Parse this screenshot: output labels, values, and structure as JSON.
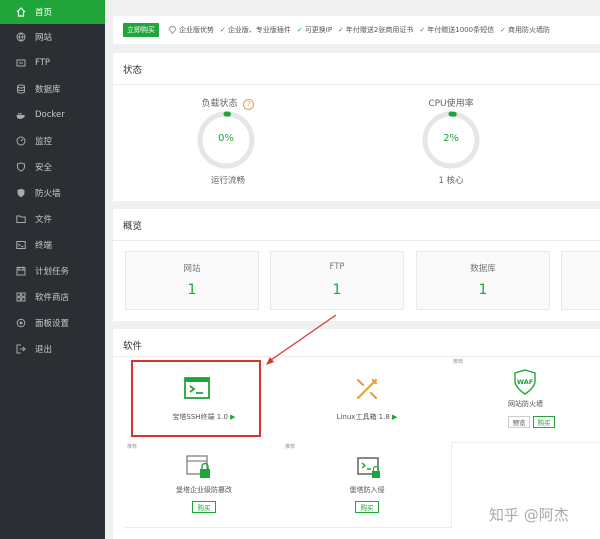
{
  "sidebar": {
    "items": [
      {
        "label": "首页",
        "icon": "home-icon",
        "active": true
      },
      {
        "label": "网站",
        "icon": "globe-icon"
      },
      {
        "label": "FTP",
        "icon": "ftp-icon"
      },
      {
        "label": "数据库",
        "icon": "database-icon"
      },
      {
        "label": "Docker",
        "icon": "docker-icon"
      },
      {
        "label": "监控",
        "icon": "monitor-icon"
      },
      {
        "label": "安全",
        "icon": "shield-icon"
      },
      {
        "label": "防火墙",
        "icon": "firewall-icon"
      },
      {
        "label": "文件",
        "icon": "folder-icon"
      },
      {
        "label": "终端",
        "icon": "terminal-icon"
      },
      {
        "label": "计划任务",
        "icon": "calendar-icon"
      },
      {
        "label": "软件商店",
        "icon": "grid-icon"
      },
      {
        "label": "面板设置",
        "icon": "settings-icon"
      },
      {
        "label": "退出",
        "icon": "logout-icon"
      }
    ]
  },
  "ad": {
    "buy_label": "立即购买",
    "lead": "企业版优势",
    "features": [
      "企业版、专业版插件",
      "可更换IP",
      "年付赠送2张商用证书",
      "年付赠送1000条短信",
      "商用防火墙防"
    ]
  },
  "status": {
    "title": "状态",
    "load": {
      "label": "负载状态",
      "value": "0%",
      "sub": "运行流畅",
      "percent": 0
    },
    "cpu": {
      "label": "CPU使用率",
      "value": "2%",
      "sub": "1 核心",
      "percent": 2
    }
  },
  "overview": {
    "title": "概览",
    "boxes": [
      {
        "label": "网站",
        "value": "1"
      },
      {
        "label": "FTP",
        "value": "1"
      },
      {
        "label": "数据库",
        "value": "1"
      }
    ]
  },
  "software": {
    "title": "软件",
    "recommend_tag": "推荐",
    "items": [
      {
        "name": "宝塔SSH终端 1.0",
        "icon": "ssh-terminal-icon"
      },
      {
        "name": "Linux工具箱 1.8",
        "icon": "tools-icon"
      },
      {
        "name": "网站防火墙",
        "icon": "waf-shield-icon",
        "icon_text": "WAF",
        "preview_label": "预览",
        "buy_label": "购买"
      },
      {
        "name": "堡塔企业级防篡改",
        "icon": "tamper-lock-icon",
        "buy_label": "购买"
      },
      {
        "name": "堡塔防入侵",
        "icon": "intrusion-icon",
        "buy_label": "购买"
      }
    ]
  },
  "watermark": "知乎 @阿杰",
  "colors": {
    "accent": "#20a53a",
    "sidebar_bg": "#2b2f33",
    "annotation": "#d9342b"
  }
}
